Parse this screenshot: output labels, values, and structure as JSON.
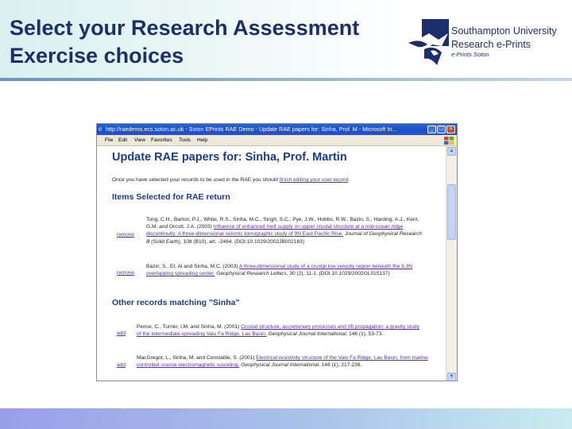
{
  "slide": {
    "title_line1": "Select your Research Assessment",
    "title_line2": "Exercise choices",
    "logo": {
      "line1": "Southampton University",
      "line2": "Research e-Prints",
      "line3": "e-Prints Soton"
    }
  },
  "browser": {
    "window_title": "http://raedemo.ecs.soton.ac.uk - Soton EPrints RAE Demo - Update RAE papers for: Sinha, Prof. M - Microsoft In...",
    "menu": [
      "File",
      "Edit",
      "View",
      "Favorites",
      "Tools",
      "Help"
    ]
  },
  "page": {
    "heading": "Update RAE papers for: Sinha, Prof. Martin",
    "intro_text": "Once you have selected your records to be used in the RAE you should ",
    "intro_link": "finish editing your user record",
    "intro_end": ".",
    "selected_heading": "Items Selected for RAE return",
    "selected": [
      {
        "action": "remove",
        "authors": "Tong, C.H., Barton, P.J., White, R.S., Sinha, M.C., Singh, S.C., Pye, J.W., Hobbs, R.W., Bazin, S., Harding, A.J., Kent, G.M. and Orcutt, J.A. (2003) ",
        "title": "Influence of enhanced melt supply on upper crustal structure at a mid-ocean ridge discontinuity: A three-dimensional seismic tomographic study of 9N East Pacific Rise.",
        "journal": " Journal of Geophysical Research B (Solid Earth)",
        "rest": ", 108 (B10), art. -2464. (DOI:10.1029/2002JB002163)"
      },
      {
        "action": "remove",
        "authors": "Bazin, S., Et, Al and Sinha, M.C. (2003) ",
        "title": "A three-dimensional study of a crustal low velocity region beneath the 9.3N overlapping spreading center.",
        "journal": " Geophysical Research Letters",
        "rest": ", 30 (2), 11-1. (DOI 10.1029/2002GL015137)"
      }
    ],
    "other_heading": "Other records matching \"Sinha\"",
    "other": [
      {
        "action": "add",
        "authors": "Peirce, C., Turner, I.M. and Sinha, M. (2001) ",
        "title": "Crustal structure, accretionary processes and rift propagation: a gravity study of the intermediate-spreading Valu Fa Ridge, Lau Basin.",
        "journal": " Geophysical Journal International",
        "rest": ", 146 (1), 53-73."
      },
      {
        "action": "add",
        "authors": "MacGregor, L., Sinha, M. and Constable, S. (2001) ",
        "title": "Electrical resistivity structure of the Valu Fa Ridge, Lau Basin, from marine controlled-source electromagnetic sounding.",
        "journal": " Geophysical Journal International",
        "rest": ", 146 (1), 217-236."
      }
    ]
  }
}
